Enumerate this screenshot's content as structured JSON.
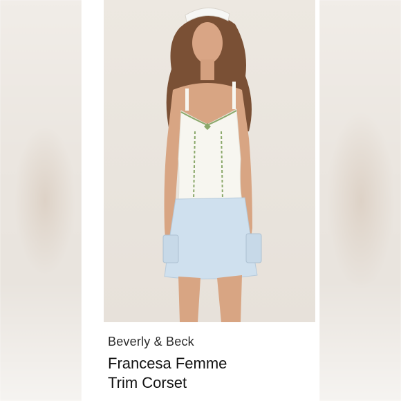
{
  "listing": {
    "brand": "Beverly & Beck",
    "product_line1": "Francesa Femme",
    "product_line2": "Trim Corset"
  },
  "colors": {
    "background": "#ffffff",
    "photo_backdrop": "#ebe6df",
    "corset": "#f7f6f0",
    "trim_green": "#8aa86a",
    "denim": "#cfe0ee"
  }
}
